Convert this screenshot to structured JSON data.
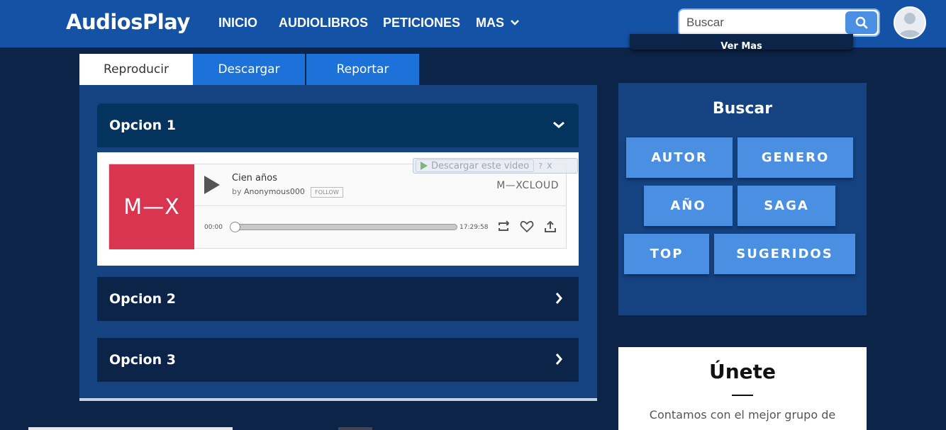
{
  "header": {
    "logo": "AudiosPlay",
    "nav": [
      {
        "label": "INICIO"
      },
      {
        "label": "AUDIOLIBROS"
      },
      {
        "label": "PETICIONES"
      },
      {
        "label": "MAS"
      }
    ],
    "search": {
      "placeholder": "Buscar"
    },
    "avatar_icon": "user-avatar-icon"
  },
  "tabs": [
    {
      "label": "Reproducir",
      "active": true
    },
    {
      "label": "Descargar",
      "active": false
    },
    {
      "label": "Reportar",
      "active": false
    }
  ],
  "options": [
    {
      "title": "Opcion 1",
      "expanded": true
    },
    {
      "title": "Opcion 2",
      "expanded": false
    },
    {
      "title": "Opcion 3",
      "expanded": false
    }
  ],
  "player": {
    "artwork_text": "M—X",
    "track_title": "Cien años",
    "by_prefix": "by",
    "user": "Anonymous000",
    "follow_label": "FOLLOW",
    "brand": "M—XCLOUD",
    "time_start": "00:00",
    "time_end": "17:29:58",
    "progress": 0.0,
    "download_overlay": {
      "label": "Descargar este video",
      "help": "?",
      "close": "X"
    }
  },
  "sidebar": {
    "top_card_link": "Ver Mas",
    "search_title": "Buscar",
    "categories": [
      "AUTOR",
      "GENERO",
      "AÑO",
      "SAGA",
      "TOP",
      "SUGERIDOS"
    ],
    "join": {
      "title": "Únete",
      "text": "Contamos con el mejor grupo de"
    }
  },
  "colors": {
    "header": "#1452a5",
    "background": "#0b2447",
    "panel": "#154280",
    "accent": "#4b8fe2",
    "mixcloud_red": "#d93551"
  }
}
